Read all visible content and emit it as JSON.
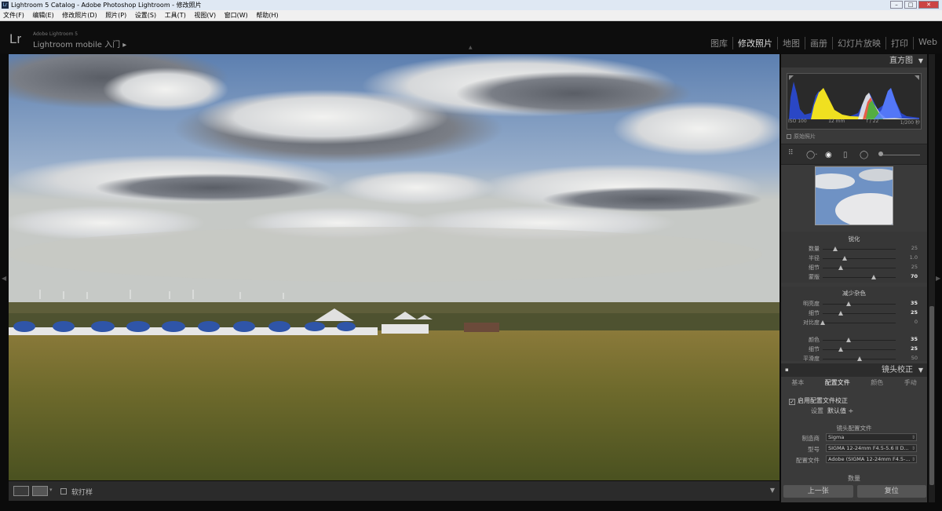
{
  "window": {
    "title": "Lightroom 5 Catalog - Adobe Photoshop Lightroom - 修改照片",
    "icon": "Lr"
  },
  "menu": [
    "文件(F)",
    "编辑(E)",
    "修改照片(D)",
    "照片(P)",
    "设置(S)",
    "工具(T)",
    "视图(V)",
    "窗口(W)",
    "帮助(H)"
  ],
  "identity": {
    "logo": "Lr",
    "product": "Adobe Lightroom 5",
    "mobile": "Lightroom mobile 入门 ▸"
  },
  "modules": [
    "图库",
    "修改照片",
    "地图",
    "画册",
    "幻灯片放映",
    "打印",
    "Web"
  ],
  "histogram": {
    "title": "直方图",
    "iso": "ISO 100",
    "focal": "12 mm",
    "aperture": "f / 22",
    "shutter": "1/200 秒",
    "original_label": "原始照片"
  },
  "sharpening": {
    "title": "锐化",
    "rows": [
      {
        "label": "数量",
        "value": "25",
        "level": 0.17
      },
      {
        "label": "半径",
        "value": "1.0",
        "level": 0.3
      },
      {
        "label": "细节",
        "value": "25",
        "level": 0.25
      },
      {
        "label": "蒙版",
        "value": "70",
        "level": 0.7,
        "bold": true
      }
    ]
  },
  "noise": {
    "title": "减少杂色",
    "rows": [
      {
        "label": "明亮度",
        "value": "35",
        "level": 0.35,
        "bold": true
      },
      {
        "label": "细节",
        "value": "25",
        "level": 0.25,
        "bold": true
      },
      {
        "label": "对比度",
        "value": "0",
        "level": 0.0
      },
      {
        "label": "颜色",
        "value": "35",
        "level": 0.35,
        "bold": true
      },
      {
        "label": "细节",
        "value": "25",
        "level": 0.25,
        "bold": true
      },
      {
        "label": "平滑度",
        "value": "50",
        "level": 0.5
      }
    ]
  },
  "lens": {
    "title": "镜头校正",
    "tabs": [
      "基本",
      "配置文件",
      "颜色",
      "手动"
    ],
    "active_tab": "配置文件",
    "enable_label": "启用配置文件校正",
    "setup_label": "设置",
    "setup_value": "默认值 ÷",
    "profile_title": "镜头配置文件",
    "rows": [
      {
        "label": "制造商",
        "value": "Sigma"
      },
      {
        "label": "型号",
        "value": "SIGMA 12-24mm F4.5-5.6 II D..."
      },
      {
        "label": "配置文件",
        "value": "Adobe (SIGMA 12-24mm F4.5-..."
      }
    ],
    "amount_label": "数量"
  },
  "buttons": {
    "previous": "上一张",
    "reset": "复位"
  },
  "toolbar": {
    "softproof": "软打样"
  }
}
